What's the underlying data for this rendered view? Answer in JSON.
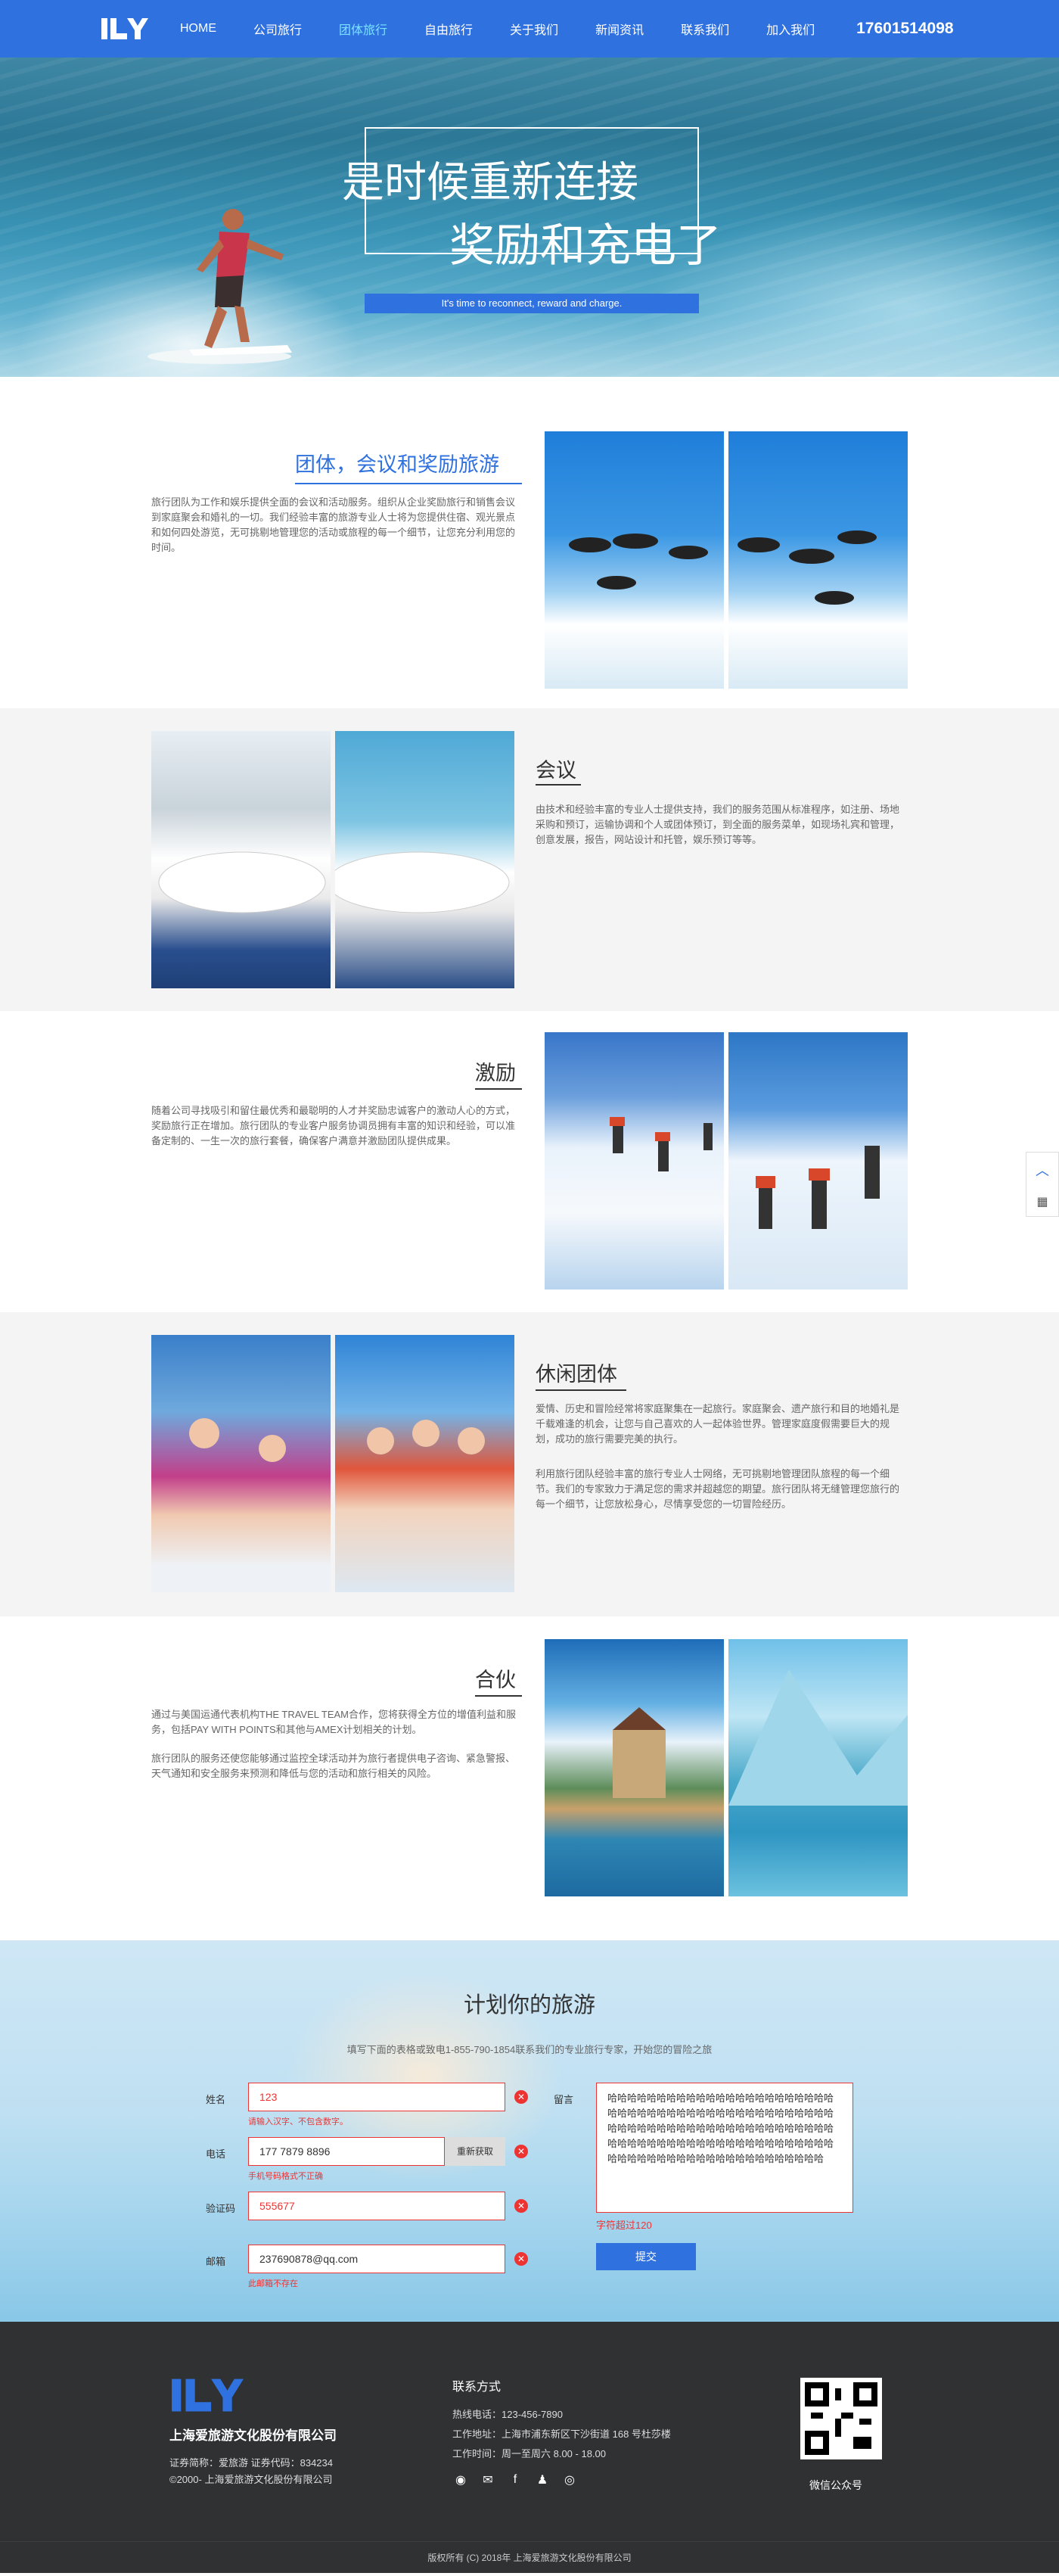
{
  "nav": {
    "items": [
      "HOME",
      "公司旅行",
      "团体旅行",
      "自由旅行",
      "关于我们",
      "新闻资讯",
      "联系我们",
      "加入我们"
    ],
    "active_index": 2,
    "phone": "17601514098",
    "accent": "#2f71df",
    "active_color": "#79e3ff"
  },
  "hero": {
    "line1": "是时候重新连接",
    "line2": "奖励和充电了",
    "subtitle": "It's time to reconnect, reward and charge."
  },
  "sections": [
    {
      "title": "团体，会议和奖励旅游",
      "text": "旅行团队为工作和娱乐提供全面的会议和活动服务。组织从企业奖励旅行和销售会议到家庭聚会和婚礼的一切。我们经验丰富的旅游专业人士将为您提供住宿、观光景点和如何四处游览，无可挑剔地管理您的活动或旅程的每一个细节，让您充分利用您的时间。"
    },
    {
      "title": "会议",
      "text": "由技术和经验丰富的专业人士提供支持，我们的服务范围从标准程序，如注册、场地采购和预订，运输协调和个人或团体预订，到全面的服务菜单，如现场礼宾和管理，创意发展，报告，网站设计和托管，娱乐预订等等。"
    },
    {
      "title": "激励",
      "text": "随着公司寻找吸引和留住最优秀和最聪明的人才并奖励忠诚客户的激动人心的方式，奖励旅行正在增加。旅行团队的专业客户服务协调员拥有丰富的知识和经验，可以准备定制的、一生一次的旅行套餐，确保客户满意并激励团队提供成果。"
    },
    {
      "title": "休闲团体",
      "text": "爱情、历史和冒险经常将家庭聚集在一起旅行。家庭聚会、遗产旅行和目的地婚礼是千载难逢的机会，让您与自己喜欢的人一起体验世界。管理家庭度假需要巨大的规划，成功的旅行需要完美的执行。",
      "text2": "利用旅行团队经验丰富的旅行专业人士网络，无可挑剔地管理团队旅程的每一个细节。我们的专家致力于满足您的需求并超越您的期望。旅行团队将无缝管理您旅行的每一个细节，让您放松身心，尽情享受您的一切冒险经历。"
    },
    {
      "title": "合伙",
      "text": "通过与美国运通代表机构THE TRAVEL TEAM合作，您将获得全方位的增值利益和服务，包括PAY WITH POINTS和其他与AMEX计划相关的计划。",
      "text2": "旅行团队的服务还使您能够通过监控全球活动并为旅行者提供电子咨询、紧急警报、天气通知和安全服务来预测和降低与您的活动和旅行相关的风险。"
    }
  ],
  "plan": {
    "title": "计划你的旅游",
    "subtitle": "填写下面的表格或致电1-855-790-1854联系我们的专业旅行专家，开始您的冒险之旅",
    "name_label": "姓名",
    "name_value": "123",
    "name_error": "请输入汉字、不包含数字。",
    "phone_label": "电话",
    "phone_value": "177 7879 8896",
    "phone_error": "手机号码格式不正确",
    "code_button": "重新获取",
    "code_label": "验证码",
    "code_value": "555677",
    "email_label": "邮箱",
    "email_value": "237690878@qq.com",
    "email_error": "此邮箱不存在",
    "message_label": "留言",
    "message_value": "哈哈哈哈哈哈哈哈哈哈哈哈哈哈哈哈哈哈哈哈哈哈哈哈哈哈哈哈哈哈哈哈哈哈哈哈哈哈哈哈哈哈哈哈哈哈哈哈哈哈哈哈哈哈哈哈哈哈哈哈哈哈哈哈哈哈哈哈哈哈哈哈哈哈哈哈哈哈哈哈哈哈哈哈哈哈哈哈哈哈哈哈哈哈哈哈哈哈哈哈哈哈哈哈哈哈哈哈哈哈哈哈哈哈",
    "message_error": "字符超过120",
    "submit": "提交",
    "error_color": "#e33333"
  },
  "footer": {
    "company": "上海爱旅游文化股份有限公司",
    "stock": "证券简称：爱旅游 证券代码：834234",
    "copyright_small": "©2000- 上海爱旅游文化股份有限公司",
    "contact_title": "联系方式",
    "hotline": "热线电话：123-456-7890",
    "address": "工作地址：上海市浦东新区下沙街道 168 号杜莎楼",
    "hours": "工作时间：周一至周六 8.00 - 18.00",
    "qr_label": "微信公众号",
    "social_icons": [
      "weibo-icon",
      "wechat-icon",
      "facebook-icon",
      "qq-icon",
      "instagram-icon"
    ],
    "copyright_bar": "版权所有 (C) 2018年 上海爱旅游文化股份有限公司"
  }
}
